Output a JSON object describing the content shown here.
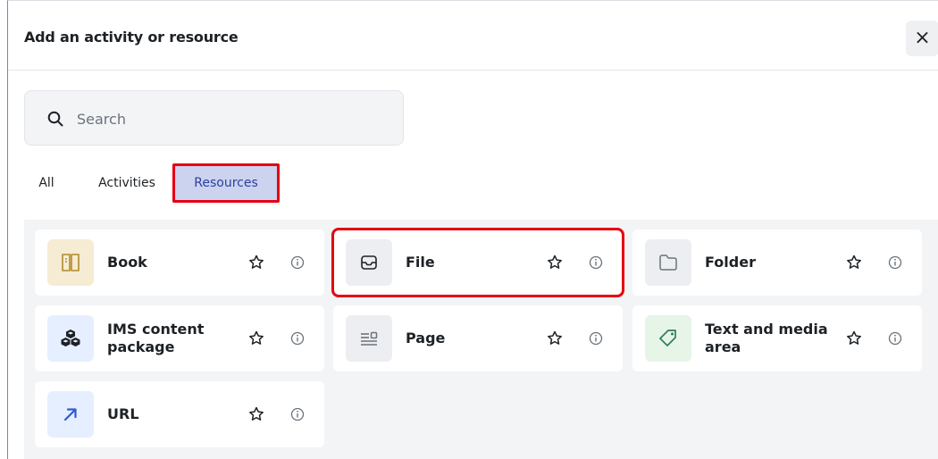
{
  "dialog": {
    "title": "Add an activity or resource",
    "close_label": "×"
  },
  "search": {
    "placeholder": "Search",
    "value": ""
  },
  "tabs": [
    {
      "label": "All",
      "selected": false
    },
    {
      "label": "Activities",
      "selected": false
    },
    {
      "label": "Resources",
      "selected": true
    }
  ],
  "items": [
    {
      "label": "Book",
      "icon": "book-icon",
      "icon_color": "#b08a2a",
      "highlighted": false
    },
    {
      "label": "File",
      "icon": "file-icon",
      "icon_color": "#1d2125",
      "highlighted": true
    },
    {
      "label": "Folder",
      "icon": "folder-icon",
      "icon_color": "#6a737b",
      "highlighted": false
    },
    {
      "label": "IMS content package",
      "icon": "cubes-icon",
      "icon_color": "#1d2125",
      "highlighted": false
    },
    {
      "label": "Page",
      "icon": "page-icon",
      "icon_color": "#6a737b",
      "highlighted": false
    },
    {
      "label": "Text and media area",
      "icon": "tag-icon",
      "icon_color": "#2e7d5b",
      "highlighted": false
    },
    {
      "label": "URL",
      "icon": "link-arrow-icon",
      "icon_color": "#2d5bd6",
      "highlighted": false
    }
  ],
  "colors": {
    "highlight": "#e60012",
    "tab_selected_bg": "#cbd3ef",
    "tab_selected_text": "#2a3f9e"
  }
}
